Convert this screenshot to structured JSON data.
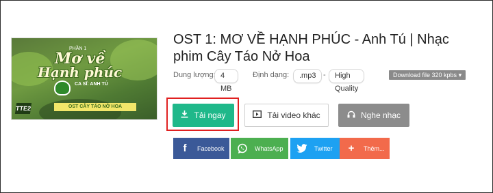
{
  "song": {
    "title": "OST 1: MƠ VỀ HẠNH PHÚC - Anh Tú | Nhạc phim Cây Táo Nở Hoa"
  },
  "thumbnail": {
    "phan": "PHẦN 1",
    "art_line1": "Mơ về",
    "art_line2": "Hạnh phúc",
    "singer": "CA SĨ: ANH TÚ",
    "band": "OST CÂY TÁO NỞ HOA",
    "logo": "TTE2"
  },
  "meta": {
    "size_label": "Dung lượng:",
    "size_value": "4 MB",
    "format_label": "Định dạng:",
    "format_value": ".mp3",
    "separator": "-",
    "quality_value": "High Quality",
    "download_select": "Download file 320 kpbs"
  },
  "actions": {
    "download_label": "Tải ngay",
    "other_video_label": "Tải video khác",
    "listen_label": "Nghe nhạc"
  },
  "share": {
    "facebook": "Facebook",
    "whatsapp": "WhatsApp",
    "twitter": "Twitter",
    "more": "Thêm..."
  },
  "colors": {
    "download": "#1fb88a",
    "facebook": "#3b5998",
    "whatsapp": "#4caf50",
    "twitter": "#1da1f2",
    "more": "#f26a4b",
    "highlight": "#e02020"
  },
  "icons": {
    "download": "download-icon",
    "video": "video-icon",
    "listen": "headphones-icon",
    "facebook": "facebook-icon",
    "whatsapp": "whatsapp-icon",
    "twitter": "twitter-icon",
    "more": "plus-icon",
    "dropdown": "caret-down-icon"
  }
}
